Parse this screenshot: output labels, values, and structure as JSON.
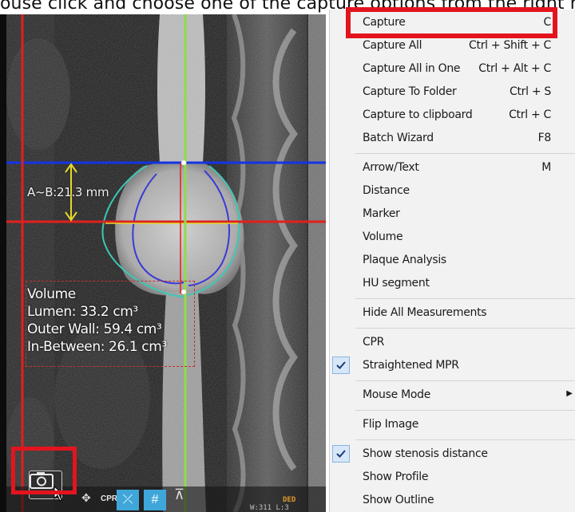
{
  "caption": "ouse click and choose one of the capture options from the right m",
  "viewer": {
    "measurement_label": "A~B:21.3 mm",
    "volume": {
      "title": "Volume",
      "lumen": "Lumen: 33.2 cm³",
      "outer_wall": "Outer Wall: 59.4 cm³",
      "in_between": "In-Between: 26.1 cm³"
    },
    "toolbar": {
      "cpr_label": "CPR",
      "wl_text": "W:311 L:3",
      "wl_text2": "DED"
    }
  },
  "menu": {
    "groups": [
      [
        {
          "label": "Capture",
          "shortcut": "C"
        },
        {
          "label": "Capture All",
          "shortcut": "Ctrl + Shift + C"
        },
        {
          "label": "Capture All in One",
          "shortcut": "Ctrl + Alt + C"
        },
        {
          "label": "Capture To Folder",
          "shortcut": "Ctrl + S"
        },
        {
          "label": "Capture to clipboard",
          "shortcut": "Ctrl + C"
        },
        {
          "label": "Batch Wizard",
          "shortcut": "F8"
        }
      ],
      [
        {
          "label": "Arrow/Text",
          "shortcut": "M"
        },
        {
          "label": "Distance",
          "shortcut": ""
        },
        {
          "label": "Marker",
          "shortcut": ""
        },
        {
          "label": "Volume",
          "shortcut": ""
        },
        {
          "label": "Plaque Analysis",
          "shortcut": ""
        },
        {
          "label": "HU segment",
          "shortcut": ""
        }
      ],
      [
        {
          "label": "Hide All Measurements",
          "shortcut": ""
        }
      ],
      [
        {
          "label": "CPR",
          "shortcut": ""
        },
        {
          "label": "Straightened MPR",
          "shortcut": "",
          "checked": true
        }
      ],
      [
        {
          "label": "Mouse Mode",
          "shortcut": "",
          "submenu": true
        }
      ],
      [
        {
          "label": "Flip Image",
          "shortcut": ""
        }
      ],
      [
        {
          "label": "Show stenosis distance",
          "shortcut": "",
          "checked": true
        },
        {
          "label": "Show Profile",
          "shortcut": ""
        },
        {
          "label": "Show Outline",
          "shortcut": ""
        }
      ]
    ]
  },
  "colors": {
    "highlight": "#e3141e",
    "crosshair_red": "#e0201e",
    "crosshair_green": "#8fdc4a",
    "crosshair_blue": "#1434e6",
    "outline_teal": "#3ec7b5",
    "outline_blue": "#3a3ad8",
    "check_bg": "#d6e7f8"
  }
}
